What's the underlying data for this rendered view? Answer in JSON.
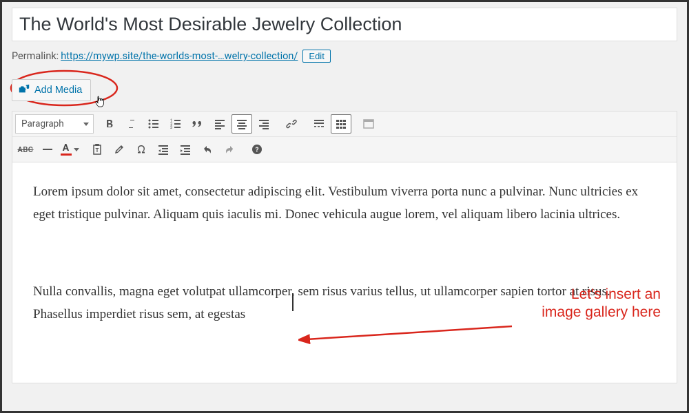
{
  "title": "The World's Most Desirable Jewelry Collection",
  "permalink": {
    "label": "Permalink:",
    "base": "https://mywp.site/",
    "slug": "the-worlds-most-…welry-collection/",
    "edit_label": "Edit"
  },
  "add_media_label": "Add Media",
  "format_select": "Paragraph",
  "annotation": {
    "line1": "Let's insert an",
    "line2": "image gallery here"
  },
  "body": {
    "p1": "Lorem ipsum dolor sit amet, consectetur adipiscing elit. Vestibulum viverra porta nunc a pulvinar. Nunc ultricies ex eget tristique pulvinar. Aliquam quis iaculis mi. Donec vehicula augue lorem, vel aliquam libero lacinia ultrices.",
    "p2": "Nulla convallis, magna eget volutpat ullamcorper, sem risus varius tellus, ut ullamcorper sapien tortor at risus. Phasellus imperdiet risus sem, at egestas"
  },
  "toolbar_icons": {
    "bold": "bold-icon",
    "italic": "italic-icon",
    "ul": "bulleted-list-icon",
    "ol": "numbered-list-icon",
    "quote": "blockquote-icon",
    "align_left": "align-left-icon",
    "align_center": "align-center-icon",
    "align_right": "align-right-icon",
    "link": "link-icon",
    "more": "insert-more-icon",
    "toolbar_toggle": "toolbar-toggle-icon",
    "fullscreen": "fullscreen-icon",
    "strike": "strikethrough-icon",
    "hr": "horizontal-rule-icon",
    "color": "text-color-icon",
    "paste": "paste-text-icon",
    "clear": "clear-formatting-icon",
    "special": "special-char-icon",
    "outdent": "outdent-icon",
    "indent": "indent-icon",
    "undo": "undo-icon",
    "redo": "redo-icon",
    "help": "help-icon"
  }
}
